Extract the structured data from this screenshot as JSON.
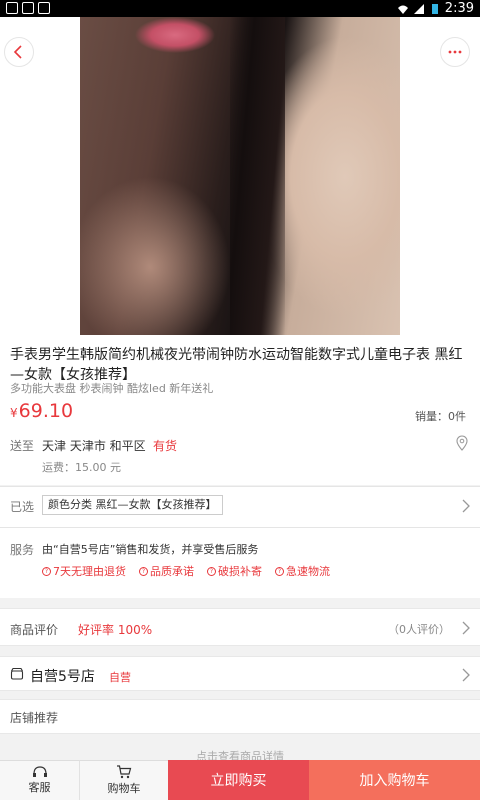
{
  "status_bar": {
    "time": "2:39"
  },
  "product": {
    "title": "手表男学生韩版简约机械夜光带闹钟防水运动智能数字式儿童电子表 黑红—女款【女孩推荐】",
    "subtitle": "多功能大表盘 秒表闹钟 酷炫led 新年送礼",
    "currency": "¥",
    "price": "69.10",
    "sales": "销量：0件"
  },
  "shipping": {
    "label": "送至",
    "address": "天津 天津市 和平区",
    "stock": "有货",
    "fee": "运费：15.00 元"
  },
  "selected": {
    "label": "已选",
    "value": "颜色分类 黑红—女款【女孩推荐】"
  },
  "service": {
    "label": "服务",
    "text": "由“自营5号店”销售和发货，并享受售后服务",
    "tags": [
      "7天无理由退货",
      "品质承诺",
      "破损补寄",
      "急速物流"
    ]
  },
  "reviews": {
    "label": "商品评价",
    "rate": "好评率 100%",
    "count": "（0人评价）"
  },
  "store": {
    "name": "自营5号店",
    "tag": "自营"
  },
  "recommend": {
    "label": "店铺推荐"
  },
  "hint": "点击查看商品详情",
  "bottom_bar": {
    "service_label": "客服",
    "cart_label": "购物车",
    "buy_label": "立即购买",
    "add_cart_label": "加入购物车"
  },
  "colors": {
    "accent": "#e8383c",
    "buy_bg": "#e84a52",
    "add_cart_bg": "#f46f5c"
  }
}
